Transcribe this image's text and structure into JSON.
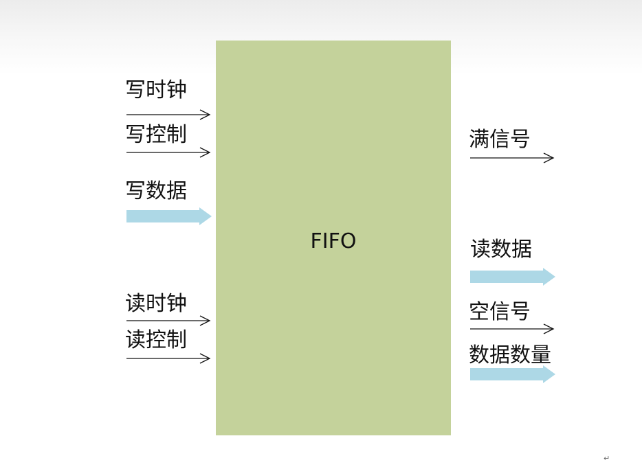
{
  "block": {
    "label": "FIFO"
  },
  "inputs": {
    "write_clock": "写时钟",
    "write_control": "写控制",
    "write_data": "写数据",
    "read_clock": "读时钟",
    "read_control": "读控制"
  },
  "outputs": {
    "full_signal": "满信号",
    "read_data": "读数据",
    "empty_signal": "空信号",
    "data_count": "数据数量"
  },
  "paragraph_mark": "↵",
  "colors": {
    "block_fill": "#c4d29b",
    "data_arrow": "#add8e6",
    "signal_arrow": "#111111",
    "text": "#111111"
  }
}
